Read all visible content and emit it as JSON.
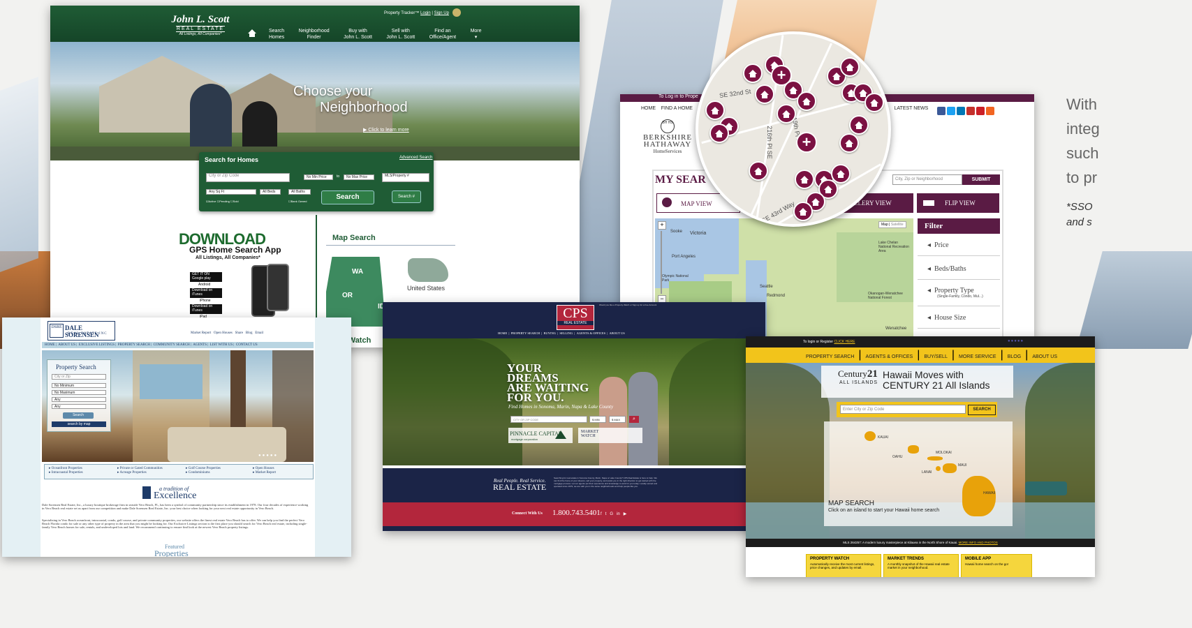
{
  "side_text": {
    "line1": "With",
    "line2": "integ",
    "line3": "such",
    "line4": "to pr",
    "note1": "*SSO",
    "note2": "and s"
  },
  "jls": {
    "logo_name": "John L. Scott",
    "logo_sub": "REAL ESTATE",
    "logo_tag": "All Listings, All Companies*",
    "top_links": {
      "tracker": "Property Tracker™",
      "login": "Login",
      "sep": "|",
      "signup": "Sign Up"
    },
    "nav": [
      {
        "l1": "Search",
        "l2": "Homes"
      },
      {
        "l1": "Neighborhood",
        "l2": "Finder"
      },
      {
        "l1": "Buy with",
        "l2": "John L. Scott"
      },
      {
        "l1": "Sell with",
        "l2": "John L. Scott"
      },
      {
        "l1": "Find an",
        "l2": "Office/Agent"
      },
      {
        "l1": "More",
        "l2": ""
      }
    ],
    "hero_line1": "Choose your",
    "hero_line2": "Neighborhood",
    "hero_link": "Click to learn more",
    "search_title": "Search for Homes",
    "advanced": "Advanced Search",
    "city_placeholder": "City or Zip Code",
    "min_price": "No Min Price",
    "to": "to",
    "max_price": "No Max Price",
    "mls": "MLS/Property #",
    "sqft": "Any Sq Ft",
    "beds": "All Beds",
    "baths": "All Baths",
    "checks": [
      "Active",
      "Pending",
      "Sold"
    ],
    "bank_owned": "Bank Owned",
    "search_btn": "Search",
    "search_hash_btn": "Search #",
    "download": "DOWNLOAD",
    "app_title": "GPS Home Search App",
    "app_sub": "All Listings, All Companies*",
    "stores": [
      {
        "small": "GET IT ON",
        "big": "Google play",
        "label": "Android"
      },
      {
        "small": "Download on",
        "big": "iTunes",
        "label": "iPhone"
      },
      {
        "small": "Download on",
        "big": "iTunes",
        "label": "iPad"
      }
    ],
    "map_search": "Map Search",
    "states": [
      "WA",
      "OR",
      "ID"
    ],
    "us_label": "United States",
    "watch": "t Watch"
  },
  "bhhs": {
    "login_bar": "To Log in to Prope",
    "nav": [
      "HOME",
      "FIND A HOME"
    ],
    "nav_right": [
      "US",
      "LATEST NEWS"
    ],
    "logo_monogram": "BH HS",
    "logo_line1": "BERKSHIRE",
    "logo_line2": "HATHAWAY",
    "logo_line3": "HomeServices",
    "my_search": "MY SEAR",
    "city_placeholder": "City, Zip or Neighborhood",
    "submit": "SUBMIT",
    "map_view": "MAP VIEW",
    "gallery_view": "GALLERY VIEW",
    "flip_view": "FLIP VIEW",
    "map_tab": "Map",
    "satellite_tab": "Satellite",
    "filter_title": "Filter",
    "filters": [
      {
        "label": "Price",
        "sub": ""
      },
      {
        "label": "Beds/Baths",
        "sub": ""
      },
      {
        "label": "Property Type",
        "sub": "(Single-Family, Condo, Mul...)"
      },
      {
        "label": "House Size",
        "sub": ""
      }
    ],
    "places": [
      "Sooke",
      "Victoria",
      "Port Angeles",
      "Olympic National Park",
      "Lake Chelan National Recreation Area",
      "Okanogan-Wenatchee National Forest",
      "Redmond",
      "Seattle",
      "Wenatchee"
    ],
    "streets": [
      "SE 32nd St",
      "216th Pl SE",
      "SE 43rd Way",
      "19th Pl SE"
    ],
    "social_colors": [
      "#3b5998",
      "#1da1f2",
      "#0077b5",
      "#c4302b",
      "#cb2027",
      "#f26522"
    ]
  },
  "dale": {
    "logo_mark": "DSRE",
    "logo_name": "DALE SORENSEN",
    "logo_sub": "REAL ESTATE INC",
    "util_links": [
      "Market Report",
      "Open Houses",
      "Share",
      "Blog",
      "Email"
    ],
    "nav": [
      "HOME",
      "ABOUT US",
      "EXCLUSIVE LISTINGS",
      "PROPERTY SEARCH",
      "COMMUNITY SEARCH",
      "AGENTS",
      "LIST WITH US",
      "CONTACT US"
    ],
    "panel_title": "Property Search",
    "city_placeholder": "City or Zip",
    "selects": [
      "No Minimum",
      "No Maximum",
      "Any",
      "Any"
    ],
    "search_btn": "Search",
    "map_link": "search by map",
    "links": [
      [
        "Oceanfront Properties",
        "Intracoastal Properties"
      ],
      [
        "Private or Gated Communities",
        "Acreage Properties"
      ],
      [
        "Golf Course Properties",
        "Condominiums"
      ],
      [
        "Open Houses",
        "Market Report"
      ]
    ],
    "tradition_small": "a tradition of",
    "tradition_big": "Excellence",
    "body1": "Dale Sorensen Real Estate, Inc., a luxury boutique brokerage firm in seaside Vero Beach, FL, has been a symbol of community partnership since its establishment in 1978. Our four decades of experience working in Vero Beach real estate set us apart from our competition and make Dale Sorensen Real Estate, Inc. your best choice when looking for your next real estate opportunity in Vero Beach.",
    "body2": "Specializing in Vero Beach oceanfront, intracoastal, condo, golf course, and private community properties, our website offers the finest real estate Vero Beach has to offer. We can help you find the perfect Vero Beach Florida condo for sale or any other type of property in the area that you might be looking for. Our Exclusive Listings section is the first place you should search for Vero Beach real estate, including single-family Vero Beach homes for sale, rentals, and undeveloped lots and land. We recommend continuing to ensure find look at the newest Vero Beach property listings.",
    "featured_small": "Featured",
    "featured_big": "Properties"
  },
  "cps": {
    "logo": "CPS",
    "logo_sub": "REAL ESTATE",
    "top_note": "Would you like a Property Watch or Sign up for a free Account",
    "nav": [
      "HOME",
      "PROPERTY SEARCH",
      "BUYING",
      "SELLING",
      "AGENTS & OFFICES",
      "ABOUT US"
    ],
    "hero": [
      "YOUR",
      "DREAMS",
      "ARE WAITING",
      "FOR YOU."
    ],
    "hero_sub": "Find Homes in Sonoma, Marin, Napa & Lake County",
    "city_placeholder": "CITY OR ZIP CODE",
    "min": "$ MIN",
    "max": "$ MAX",
    "pinnacle": "PINNACLE CAPITAL",
    "pinnacle_sub": "mortgage corporation",
    "market_watch": "MARKET WATCH",
    "tag1": "Real People. Real Service.",
    "tag2": "REAL ESTATE",
    "blurb": "Searching for real estate in Sonoma County, Marin, Napa or Lake County? CPS Real Estate is here to help. We can find the home of your dreams, sell your property, and assist you in the right direction to get started with the mortgage process. Let our agents put their experience and knowledge to work for you today. Locally owned and operated since 1979, we are with you in the same neighborhoods and help people like you.",
    "connect": "Connect With Us",
    "phone": "1.800.743.5401",
    "social": [
      "f",
      "t",
      "G",
      "in",
      "▶"
    ]
  },
  "c21": {
    "login": "To login or Register",
    "click_here": "CLICK HERE",
    "nav": [
      "PROPERTY SEARCH",
      "AGENTS & OFFICES",
      "BUY/SELL",
      "MORE SERVICE",
      "BLOG",
      "ABOUT US"
    ],
    "logo_top": "Century",
    "logo_num": "21",
    "logo_sub": "ALL ISLANDS",
    "headline1": "Hawaii Moves with",
    "headline2": "CENTURY 21 All Islands",
    "city_placeholder": "Enter City or Zip Code",
    "search_btn": "SEARCH",
    "islands": [
      "KAUAI",
      "OAHU",
      "MOLOKAI",
      "MAUI",
      "LANAI",
      "HAWAII"
    ],
    "map_title": "MAP SEARCH",
    "map_sub": "Click on an island to start your Hawaii home search",
    "ticker": "MLS 264257: A modern luxury masterpiece at Kilauea in the North Shore of Kauai.",
    "ticker_link": "MORE INFO AND PHOTOS",
    "boxes": [
      {
        "title": "PROPERTY WATCH",
        "body": "Automatically receive the most current listings, price changes, and updates by email."
      },
      {
        "title": "MARKET TRENDS",
        "body": "A monthly snapshot of the Hawaii real estate market in your neighborhood."
      },
      {
        "title": "MOBILE APP",
        "body": "Hawaii home search on the go!"
      }
    ]
  }
}
